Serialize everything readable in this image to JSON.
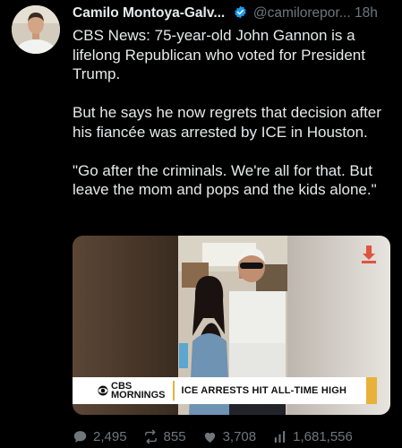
{
  "tweet": {
    "author_name": "Camilo Montoya-Galv...",
    "handle": "@camilorepor...",
    "time": "18h",
    "text": "CBS News: 75-year-old John Gannon is a lifelong Republican who voted for President Trump.\n\nBut he says he now regrets that decision after his fiancée was arrested by ICE in Houston.\n\n\"Go after the criminals. We're all for that. But leave the mom and pops and the kids alone.\""
  },
  "media": {
    "network_top": "CBS",
    "network_bottom": "MORNINGS",
    "headline": "ICE ARRESTS HIT ALL-TIME HIGH"
  },
  "actions": {
    "replies": "2,495",
    "reposts": "855",
    "likes": "3,708",
    "views": "1,681,556"
  },
  "colors": {
    "background": "#000000",
    "text": "#e7e9ea",
    "muted": "#71767b",
    "verified": "#1d9bf0",
    "accent": "#e8b23a",
    "download": "#e0533d"
  },
  "icons": {
    "verified": "verified-badge-icon",
    "reply": "reply-icon",
    "repost": "repost-icon",
    "like": "heart-icon",
    "views": "views-bar-icon",
    "download": "download-icon"
  }
}
